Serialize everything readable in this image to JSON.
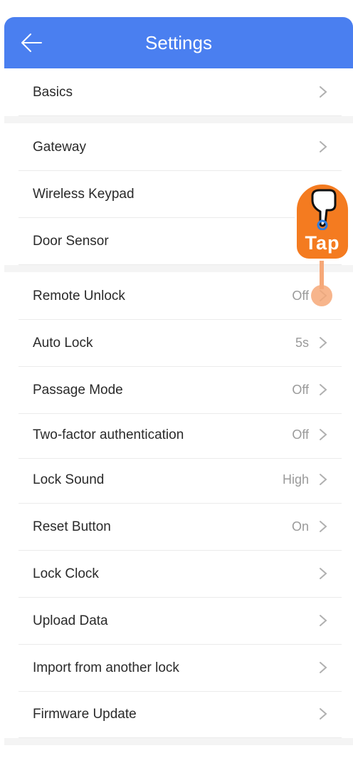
{
  "header": {
    "title": "Settings"
  },
  "rows": [
    {
      "label": "Basics",
      "value": ""
    },
    {
      "label": "Gateway",
      "value": ""
    },
    {
      "label": "Wireless Keypad",
      "value": ""
    },
    {
      "label": "Door Sensor",
      "value": ""
    },
    {
      "label": "Remote Unlock",
      "value": "Off"
    },
    {
      "label": "Auto Lock",
      "value": "5s"
    },
    {
      "label": "Passage Mode",
      "value": "Off"
    },
    {
      "label": "Two-factor authentication",
      "value": "Off"
    },
    {
      "label": "Lock Sound",
      "value": "High"
    },
    {
      "label": "Reset Button",
      "value": "On"
    },
    {
      "label": "Lock Clock",
      "value": ""
    },
    {
      "label": "Upload Data",
      "value": ""
    },
    {
      "label": "Import from another lock",
      "value": ""
    },
    {
      "label": "Firmware Update",
      "value": ""
    }
  ],
  "tap_hint": {
    "label": "Tap"
  },
  "colors": {
    "header": "#4a7ff0",
    "tap": "#f47b20"
  },
  "icons": [
    "back-arrow-icon",
    "chevron-right-icon",
    "hand-pointer-icon"
  ]
}
